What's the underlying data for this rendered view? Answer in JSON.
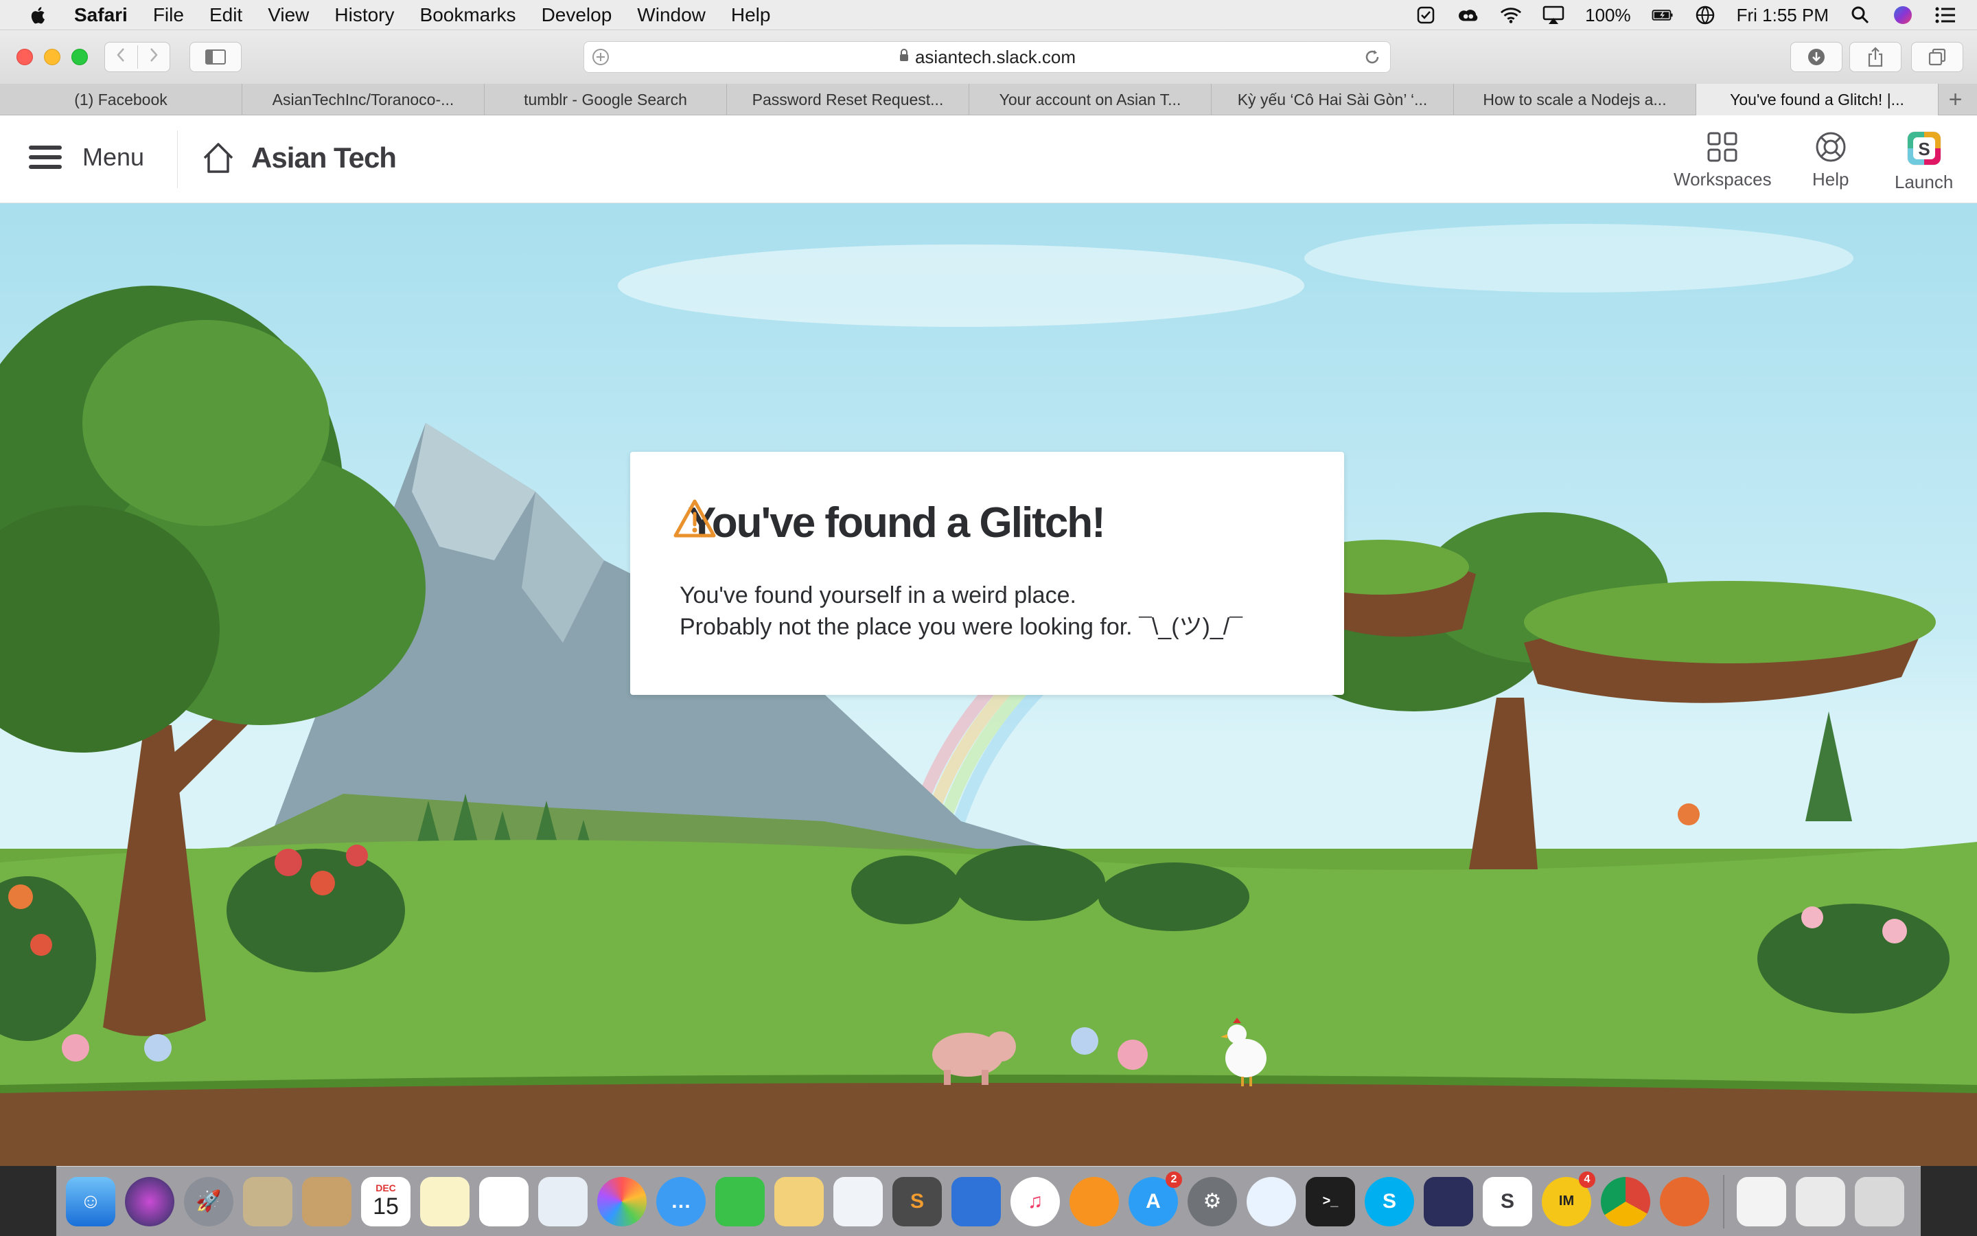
{
  "menubar": {
    "app": "Safari",
    "items": [
      "File",
      "Edit",
      "View",
      "History",
      "Bookmarks",
      "Develop",
      "Window",
      "Help"
    ],
    "battery": "100%",
    "clock": "Fri 1:55 PM"
  },
  "browser": {
    "url": "asiantech.slack.com",
    "tabs": [
      {
        "label": "(1) Facebook"
      },
      {
        "label": "AsianTechInc/Toranoco-..."
      },
      {
        "label": "tumblr - Google Search"
      },
      {
        "label": "Password Reset Request..."
      },
      {
        "label": "Your account on Asian T..."
      },
      {
        "label": "Kỳ yếu ‘Cô Hai Sài Gòn’ ‘..."
      },
      {
        "label": "How to scale a Nodejs a..."
      },
      {
        "label": "You've found a Glitch! |..."
      }
    ]
  },
  "slack": {
    "menu_label": "Menu",
    "team_name": "Asian Tech",
    "actions": {
      "workspaces": "Workspaces",
      "help": "Help",
      "launch": "Launch"
    },
    "colors": {
      "accent": "#e8912d",
      "text": "#2c2d30"
    }
  },
  "glitch": {
    "title": "You've found a Glitch!",
    "line1": "You've found yourself in a weird place.",
    "line2": "Probably not the place you were looking for. ¯\\_(ツ)_/¯"
  },
  "dock": {
    "calendar_month": "DEC",
    "calendar_day": "15",
    "badges": {
      "app_store": "2",
      "yim": "4"
    }
  }
}
